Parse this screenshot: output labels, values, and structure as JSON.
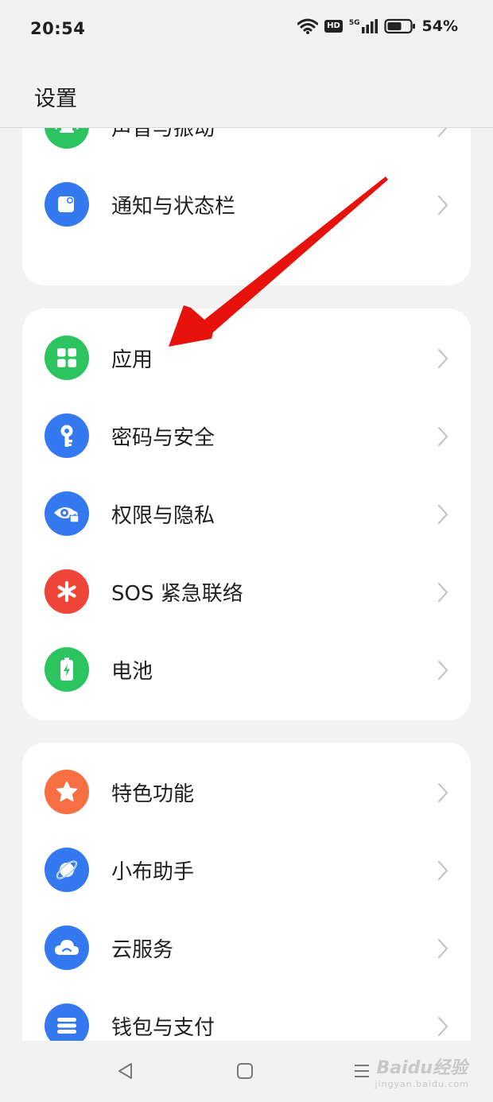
{
  "status_bar": {
    "time": "20:54",
    "hd": "HD",
    "network": "5G",
    "battery": "54%"
  },
  "header": {
    "title": "设置"
  },
  "groups": [
    {
      "items": [
        {
          "label": "声音与振动",
          "icon": "bell-icon",
          "color": "#2bc45f"
        },
        {
          "label": "通知与状态栏",
          "icon": "notification-icon",
          "color": "#3479f0"
        }
      ]
    },
    {
      "items": [
        {
          "label": "应用",
          "icon": "apps-grid-icon",
          "color": "#2bc45f"
        },
        {
          "label": "密码与安全",
          "icon": "key-icon",
          "color": "#3479f0"
        },
        {
          "label": "权限与隐私",
          "icon": "privacy-eye-icon",
          "color": "#3479f0"
        },
        {
          "label": "SOS 紧急联络",
          "icon": "sos-asterisk-icon",
          "color": "#ef4438"
        },
        {
          "label": "电池",
          "icon": "battery-icon",
          "color": "#2bc45f"
        }
      ]
    },
    {
      "items": [
        {
          "label": "特色功能",
          "icon": "star-icon",
          "color": "#f86f43"
        },
        {
          "label": "小布助手",
          "icon": "assistant-icon",
          "color": "#3479f0"
        },
        {
          "label": "云服务",
          "icon": "cloud-icon",
          "color": "#3479f0"
        },
        {
          "label": "钱包与支付",
          "icon": "wallet-icon",
          "color": "#3479f0"
        }
      ]
    }
  ],
  "watermark": {
    "main": "Baidu经验",
    "sub": "jingyan.baidu.com"
  },
  "arrow_color": "#e8120c"
}
